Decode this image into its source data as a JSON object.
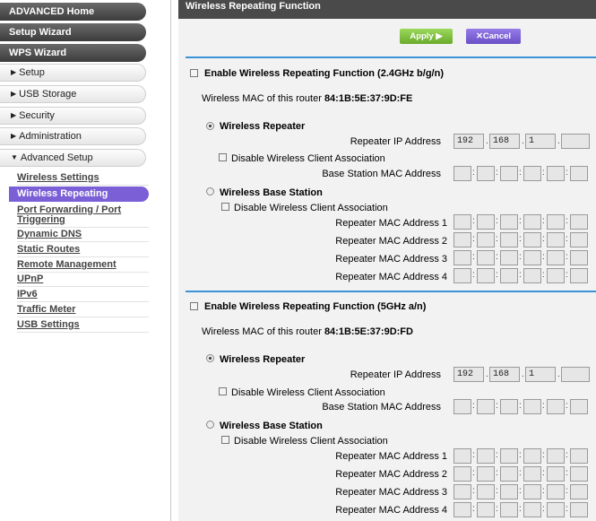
{
  "sidebar": {
    "advanced_home": "ADVANCED Home",
    "setup_wizard": "Setup Wizard",
    "wps_wizard": "WPS Wizard",
    "setup": "Setup",
    "usb_storage": "USB Storage",
    "security": "Security",
    "administration": "Administration",
    "advanced_setup": "Advanced Setup",
    "sub_items": [
      "Wireless Settings",
      "Wireless Repeating",
      "Port Forwarding / Port",
      "Triggering",
      "Dynamic DNS",
      "Static Routes",
      "Remote Management",
      "UPnP",
      "IPv6",
      "Traffic Meter",
      "USB Settings"
    ]
  },
  "header": {
    "title": "Wireless Repeating Function"
  },
  "toolbar": {
    "apply": "Apply ▶",
    "cancel": "Cancel",
    "cancel_icon": "✕"
  },
  "sections": [
    {
      "enable_label": "Enable Wireless Repeating Function (2.4GHz b/g/n)",
      "mac_prefix": "Wireless MAC of this router",
      "mac_value": "84:1B:5E:37:9D:FE",
      "repeater_label": "Wireless Repeater",
      "repeater_ip_label": "Repeater IP Address",
      "ip": [
        "192",
        "168",
        "1",
        ""
      ],
      "disable_assoc": "Disable Wireless Client Association",
      "base_mac_label": "Base Station MAC Address",
      "base_station_label": "Wireless Base Station",
      "repeater_mac_labels": [
        "Repeater MAC Address 1",
        "Repeater MAC Address 2",
        "Repeater MAC Address 3",
        "Repeater MAC Address 4"
      ]
    },
    {
      "enable_label": "Enable Wireless Repeating Function (5GHz a/n)",
      "mac_prefix": "Wireless MAC of this router",
      "mac_value": "84:1B:5E:37:9D:FD",
      "repeater_label": "Wireless Repeater",
      "repeater_ip_label": "Repeater IP Address",
      "ip": [
        "192",
        "168",
        "1",
        ""
      ],
      "disable_assoc": "Disable Wireless Client Association",
      "base_mac_label": "Base Station MAC Address",
      "base_station_label": "Wireless Base Station",
      "repeater_mac_labels": [
        "Repeater MAC Address 1",
        "Repeater MAC Address 2",
        "Repeater MAC Address 3",
        "Repeater MAC Address 4"
      ]
    }
  ],
  "colors": {
    "apply_button": "#86c440",
    "cancel_button": "#7a5fd6",
    "active_item": "#7a5fd6",
    "separator": "#3a93d6"
  }
}
